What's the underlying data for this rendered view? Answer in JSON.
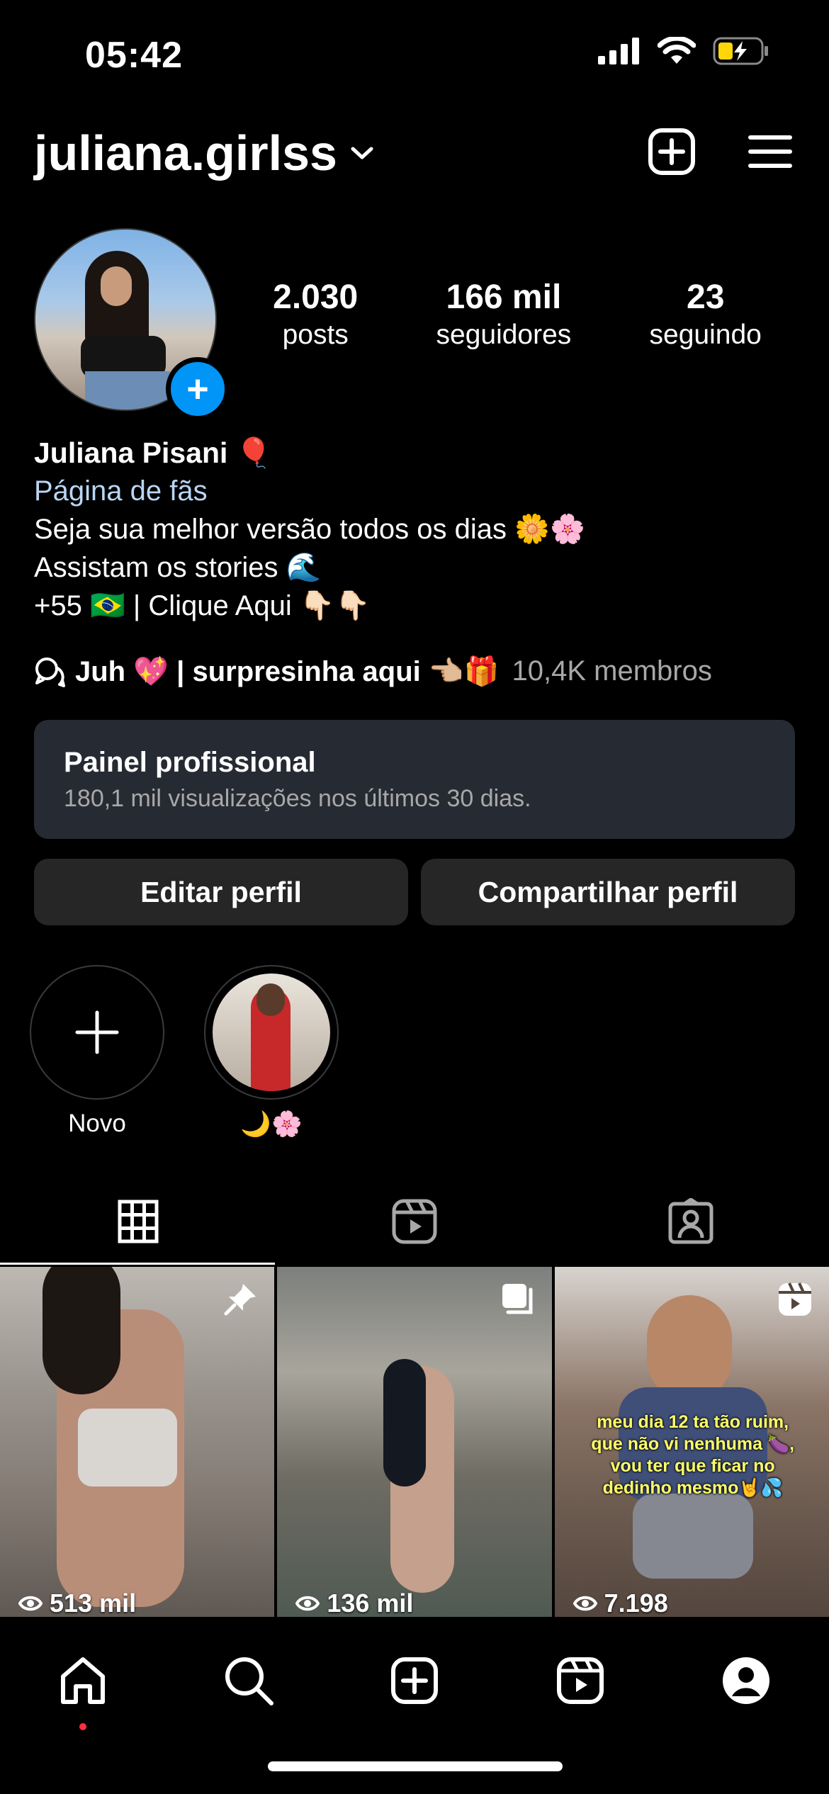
{
  "status_bar": {
    "time": "05:42"
  },
  "header": {
    "username": "juliana.girlss"
  },
  "profile": {
    "stats": [
      {
        "value": "2.030",
        "label": "posts"
      },
      {
        "value": "166 mil",
        "label": "seguidores"
      },
      {
        "value": "23",
        "label": "seguindo"
      }
    ],
    "name": "Juliana Pisani 🎈",
    "category": "Página de fãs",
    "bio_lines": [
      "Seja sua melhor versão todos os dias 🌼🌸",
      "Assistam os stories 🌊",
      "+55 🇧🇷 | Clique Aqui 👇🏻👇🏻"
    ],
    "channel": {
      "title": "Juh 💖 | surpresinha aqui 👈🏼🎁",
      "members": "10,4K membros"
    }
  },
  "dashboard": {
    "title": "Painel profissional",
    "subtitle": "180,1 mil visualizações nos últimos 30 dias."
  },
  "buttons": {
    "edit": "Editar perfil",
    "share": "Compartilhar perfil"
  },
  "highlights": [
    {
      "label": "Novo"
    },
    {
      "label": "🌙🌸"
    }
  ],
  "posts": [
    {
      "views": "513 mil"
    },
    {
      "views": "136 mil"
    },
    {
      "views": "7.198",
      "caption": "meu dia 12 ta tão ruim, que não vi nenhuma 🍆, vou ter que ficar no dedinho mesmo🤘💦"
    }
  ]
}
